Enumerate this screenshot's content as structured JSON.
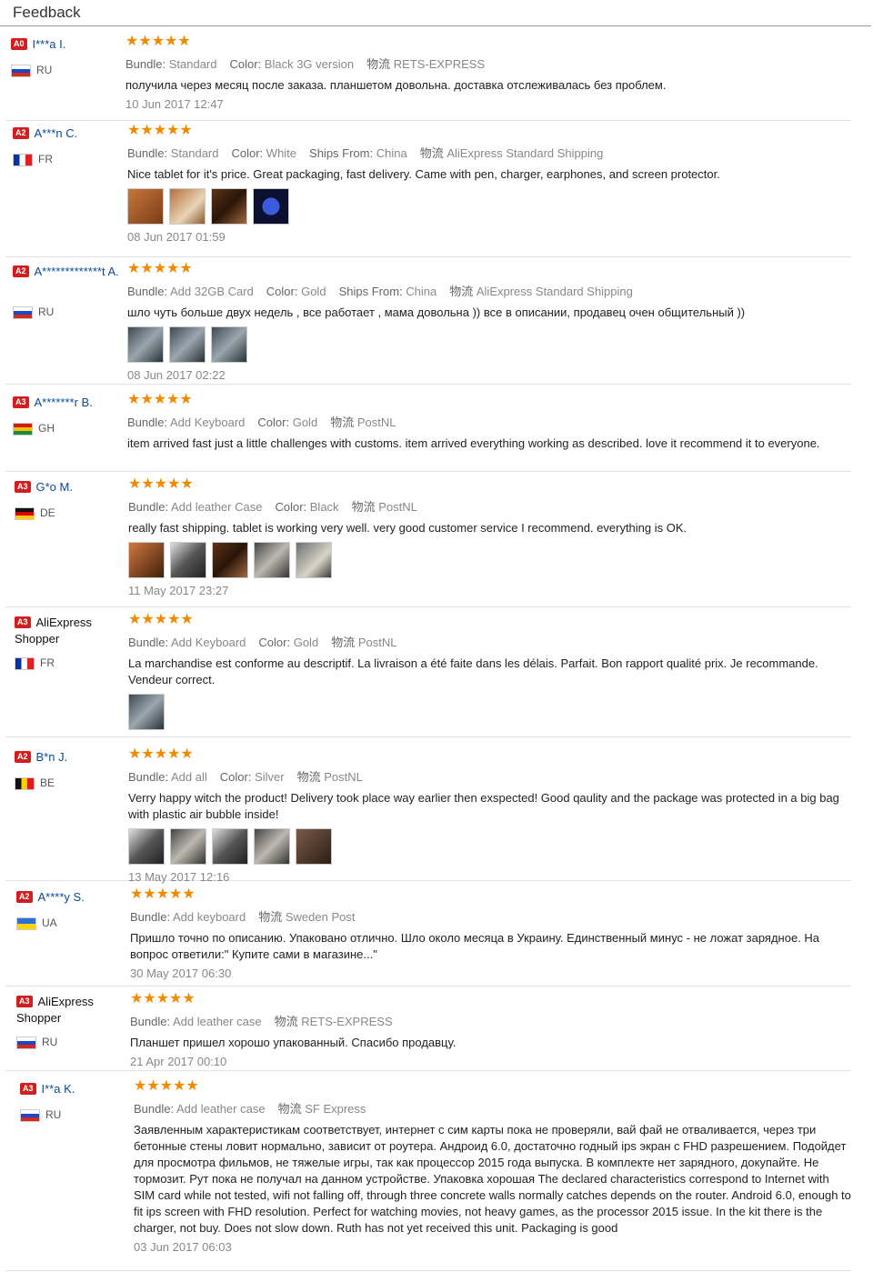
{
  "header": {
    "title": "Feedback"
  },
  "labels": {
    "bundle": "Bundle:",
    "color": "Color:",
    "ships_from": "Ships From:",
    "logistics": "物流"
  },
  "stars": "★★★★★",
  "reviews": [
    {
      "level": "A0",
      "name": "I***a I.",
      "country": "RU",
      "flag": "ru",
      "bundle": "Standard",
      "color": "Black 3G version",
      "ships_from": "",
      "shipping": "RETS-EXPRESS",
      "text": "получила через месяц после заказа. планшетом довольна. доставка отслеживалась без проблем.",
      "date": "10 Jun 2017 12:47",
      "images": 0
    },
    {
      "level": "A2",
      "name": "A***n C.",
      "country": "FR",
      "flag": "fr",
      "bundle": "Standard",
      "color": "White",
      "ships_from": "China",
      "shipping": "AliExpress Standard Shipping",
      "text": "Nice tablet for it's price. Great packaging, fast delivery. Came with pen, charger, earphones, and screen protector.",
      "date": "08 Jun 2017 01:59",
      "images": 4
    },
    {
      "level": "A2",
      "name": "A*************t A.",
      "country": "RU",
      "flag": "ru",
      "bundle": "Add 32GB Card",
      "color": "Gold",
      "ships_from": "China",
      "shipping": "AliExpress Standard Shipping",
      "text": "шло чуть больше двух недель , все работает , мама довольна )) все в описании, продавец очен общительный ))",
      "date": "08 Jun 2017 02:22",
      "images": 3
    },
    {
      "level": "A3",
      "name": "A*******r B.",
      "country": "GH",
      "flag": "gh",
      "bundle": "Add Keyboard",
      "color": "Gold",
      "ships_from": "",
      "shipping": "PostNL",
      "text": "item arrived fast just a little challenges with customs. item arrived everything working as described. love it recommend it to everyone.",
      "date": "",
      "images": 0
    },
    {
      "level": "A3",
      "name": "G*o M.",
      "country": "DE",
      "flag": "de",
      "bundle": "Add leather Case",
      "color": "Black",
      "ships_from": "",
      "shipping": "PostNL",
      "text": "really fast shipping. tablet is working very well. very good customer service I recommend. everything is OK.",
      "date": "11 May 2017 23:27",
      "images": 5
    },
    {
      "level": "A3",
      "name": "AliExpress Shopper",
      "country": "FR",
      "flag": "fr",
      "bundle": "Add Keyboard",
      "color": "Gold",
      "ships_from": "",
      "shipping": "PostNL",
      "text": "La marchandise est conforme au descriptif. La livraison a été faite dans les délais. Parfait. Bon rapport qualité prix. Je recommande. Vendeur correct.",
      "date": "",
      "images": 1
    },
    {
      "level": "A2",
      "name": "B*n J.",
      "country": "BE",
      "flag": "be",
      "bundle": "Add all",
      "color": "Silver",
      "ships_from": "",
      "shipping": "PostNL",
      "text": "Verry happy witch the product! Delivery took place way earlier then exspected! Good qaulity and the package was protected in a big bag with plastic air bubble inside!",
      "date": "13 May 2017 12:16",
      "images": 5
    },
    {
      "level": "A2",
      "name": "A****y S.",
      "country": "UA",
      "flag": "ua",
      "bundle": "Add keyboard",
      "color": "",
      "ships_from": "",
      "shipping": "Sweden Post",
      "text": "Пришло точно по описанию. Упаковано отлично. Шло около месяца в Украину. Единственный минус - не ложат зарядное. На вопрос ответили:\" Купите сами в магазине...\"",
      "date": "30 May 2017 06:30",
      "images": 0
    },
    {
      "level": "A3",
      "name": "AliExpress Shopper",
      "country": "RU",
      "flag": "ru",
      "bundle": "Add leather case",
      "color": "",
      "ships_from": "",
      "shipping": "RETS-EXPRESS",
      "text": "Планшет пришел хорошо упакованный. Спасибо продавцу.",
      "date": "21 Apr 2017 00:10",
      "images": 0
    },
    {
      "level": "A3",
      "name": "I**a K.",
      "country": "RU",
      "flag": "ru",
      "bundle": "Add leather case",
      "color": "",
      "ships_from": "",
      "shipping": "SF Express",
      "text": "Заявленным характеристикам соответствует, интернет с сим карты пока не проверяли, вай фай не отваливается, через три бетонные стены ловит нормально, зависит от роутера. Андроид 6.0, достаточно годный ips экран с FHD разрешением. Подойдет для просмотра фильмов, не тяжелые игры, так как процессор 2015 года выпуска. В комплекте нет зарядного, докупайте. Не тормозит. Рут пока не получал на данном устройстве. Упаковка хорошая The declared characteristics correspond to Internet with SIM card while not tested, wifi not falling off, through three concrete walls normally catches depends on the router. Android 6.0, enough to fit ips screen with FHD resolution. Perfect for watching movies, not heavy games, as the processor 2015 issue. In the kit there is the charger, not buy. Does not slow down. Ruth has not yet received this unit. Packaging is good",
      "date": "03 Jun 2017 06:03",
      "images": 0
    }
  ]
}
